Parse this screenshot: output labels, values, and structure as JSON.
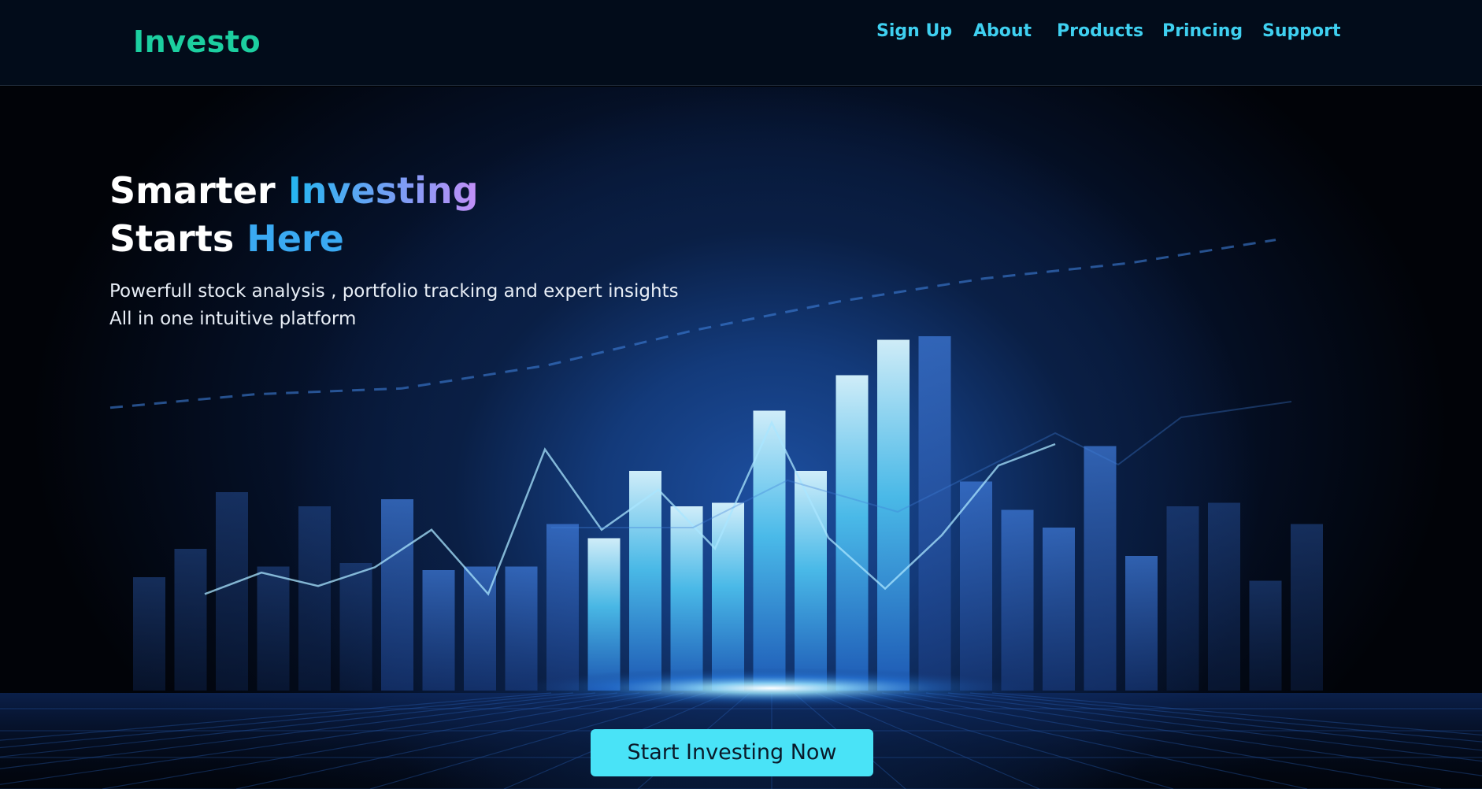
{
  "brand": {
    "name": "Investo",
    "color": "#1ccfa0"
  },
  "nav": {
    "links": [
      {
        "label": "Sign Up"
      },
      {
        "label": "About"
      },
      {
        "label": "Products"
      },
      {
        "label": "Princing"
      },
      {
        "label": "Support"
      }
    ],
    "link_color": "#3fd0f0"
  },
  "hero": {
    "headline": {
      "line1_plain": "Smarter ",
      "line1_highlight": "Investing",
      "line2_plain": "Starts ",
      "line2_highlight": "Here"
    },
    "subtext": {
      "line1": "Powerfull stock analysis , portfolio tracking and expert insights",
      "line2": "All in one intuitive platform"
    },
    "cta_label": "Start Investing Now",
    "cta_color": "#49e3f7",
    "background_image": "glowing-bar-chart-illustration",
    "illustration_bars": [
      0.32,
      0.4,
      0.56,
      0.35,
      0.52,
      0.36,
      0.54,
      0.34,
      0.35,
      0.35,
      0.47,
      0.43,
      0.62,
      0.52,
      0.53,
      0.79,
      0.62,
      0.89,
      0.99,
      1.0,
      0.59,
      0.51,
      0.46,
      0.69,
      0.38,
      0.52,
      0.53,
      0.31,
      0.47
    ],
    "illustration_line": [
      0.66,
      0.58,
      0.63,
      0.56,
      0.42,
      0.66,
      0.12,
      0.42,
      0.27,
      0.49,
      0.02,
      0.45,
      0.64,
      0.44,
      0.18,
      0.1
    ],
    "illustration_trend": [
      0.05,
      0.12,
      0.15,
      0.27,
      0.45,
      0.6,
      0.72,
      0.8,
      0.92
    ]
  }
}
